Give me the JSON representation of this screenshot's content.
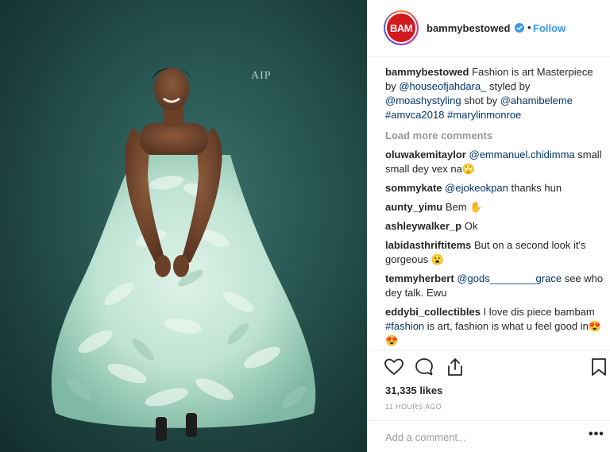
{
  "post": {
    "username": "bammybestowed",
    "avatar_text": "BAM",
    "follow_label": "Follow",
    "separator": "•",
    "photo_watermark": "AIP"
  },
  "caption": {
    "username": "bammybestowed",
    "text_1": " Fashion is art Masterpiece by ",
    "mention_1": "@houseofjahdara_",
    "text_2": " styled by ",
    "mention_2": "@moashystyling",
    "text_3": " shot by ",
    "mention_3": "@ahamibeleme",
    "hashtag_1": "#amvca2018",
    "hashtag_2": "#marylinmonroe"
  },
  "load_more_label": "Load more comments",
  "comments": [
    {
      "username": "oluwakemitaylor",
      "mention": "@emmanuel.chidimma",
      "text": " small small dey vex na🙄"
    },
    {
      "username": "sommykate",
      "mention": "@ejokeokpan",
      "text": " thanks hun"
    },
    {
      "username": "aunty_yimu",
      "mention": "",
      "text": " Bem ✋"
    },
    {
      "username": "ashleywalker_p",
      "mention": "",
      "text": " Ok"
    },
    {
      "username": "labidasthriftitems",
      "mention": "",
      "text": " But on a second look it's gorgeous 😮"
    },
    {
      "username": "temmyherbert",
      "mention": "@gods________grace",
      "text": " see who dey talk. Ewu"
    },
    {
      "username": "eddybi_collectibles",
      "mention": "",
      "text": " I love dis piece bambam ",
      "hashtag": "#fashion",
      "text_after": " is art, fashion is what u feel good in😍😍"
    }
  ],
  "actions": {
    "like_icon": "heart-icon",
    "comment_icon": "comment-icon",
    "share_icon": "share-icon",
    "save_icon": "bookmark-icon"
  },
  "likes_text": "31,335 likes",
  "timestamp": "11 HOURS AGO",
  "add_comment_placeholder": "Add a comment...",
  "more_label": "•••",
  "colors": {
    "link": "#3897f0",
    "mention": "#003569",
    "avatar_red": "#d3191f",
    "muted": "#999999"
  }
}
